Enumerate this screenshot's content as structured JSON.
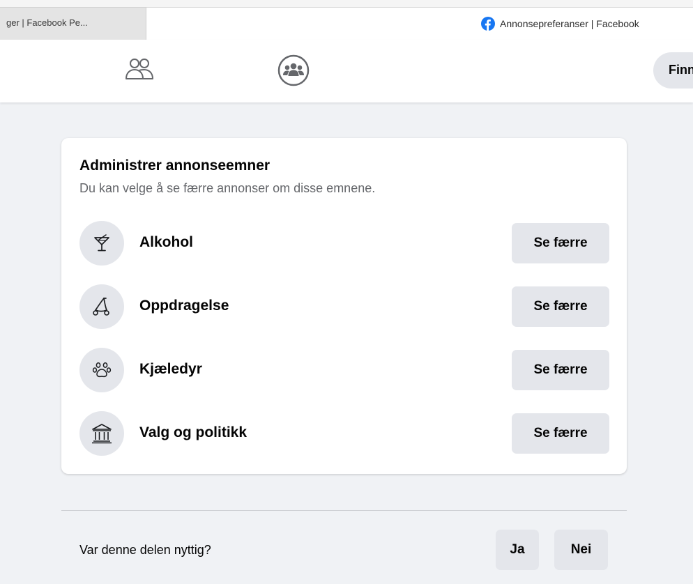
{
  "browser": {
    "tabs": [
      {
        "label": "ger | Facebook Pe...",
        "active": false
      },
      {
        "label": "Annonsepreferanser | Facebook",
        "active": true,
        "icon": "facebook-icon"
      }
    ]
  },
  "topnav": {
    "icons": [
      "friends-icon",
      "groups-icon"
    ],
    "find_label": "Finn"
  },
  "card": {
    "title": "Administrer annonseemner",
    "subtitle": "Du kan velge å se færre annonser om disse emnene.",
    "topics": [
      {
        "label": "Alkohol",
        "icon": "cocktail-icon",
        "button": "Se færre"
      },
      {
        "label": "Oppdragelse",
        "icon": "stroller-icon",
        "button": "Se færre"
      },
      {
        "label": "Kjæledyr",
        "icon": "paw-icon",
        "button": "Se færre"
      },
      {
        "label": "Valg og politikk",
        "icon": "government-building-icon",
        "button": "Se færre"
      }
    ]
  },
  "feedback": {
    "question": "Var denne delen nyttig?",
    "yes_label": "Ja",
    "no_label": "Nei"
  },
  "colors": {
    "page_bg": "#f0f2f5",
    "card_bg": "#ffffff",
    "button_bg": "#e4e6eb",
    "text_primary": "#050505",
    "text_secondary": "#65676b",
    "facebook_blue": "#1877f2"
  }
}
